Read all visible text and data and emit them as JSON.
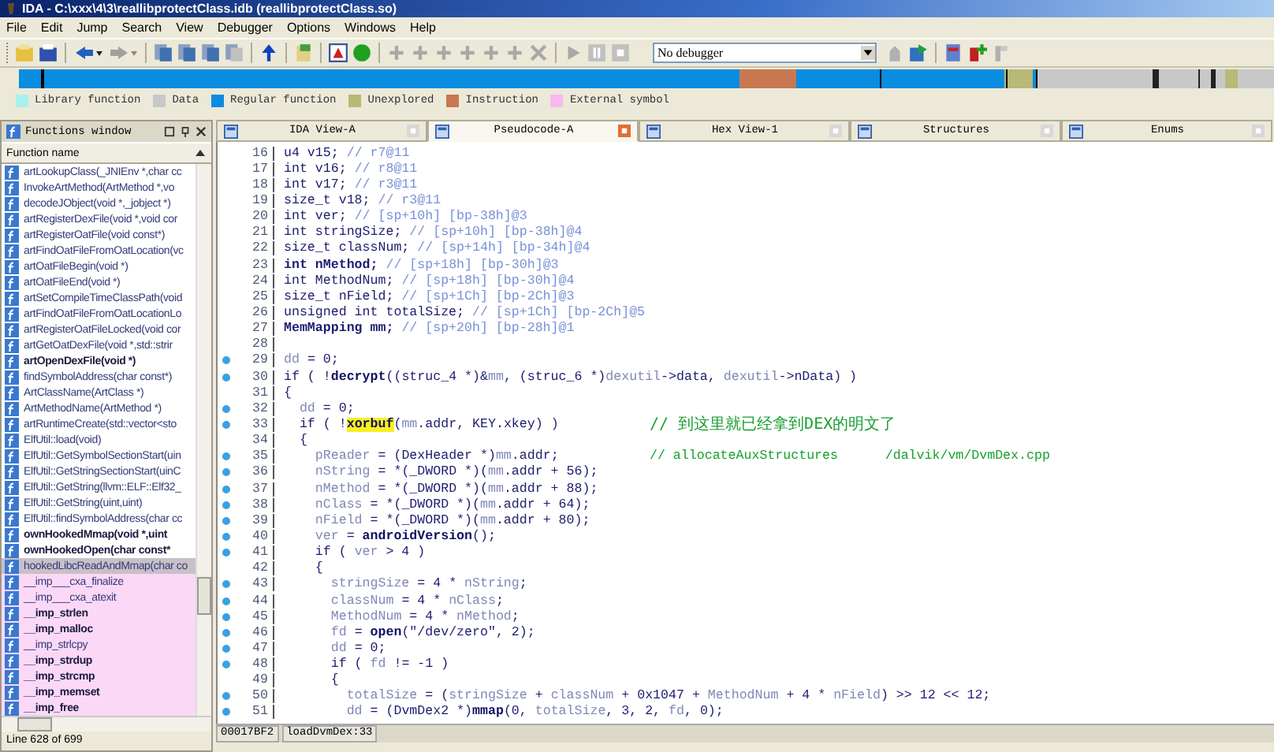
{
  "window": {
    "title": "IDA - C:\\xxx\\4\\3\\reallibprotectClass.idb (reallibprotectClass.so)"
  },
  "menu": [
    "File",
    "Edit",
    "Jump",
    "Search",
    "View",
    "Debugger",
    "Options",
    "Windows",
    "Help"
  ],
  "debugger_select": {
    "value": "No debugger"
  },
  "legend": [
    {
      "label": "Library function",
      "color": "#a8f0f0"
    },
    {
      "label": "Data",
      "color": "#c8c8c8"
    },
    {
      "label": "Regular function",
      "color": "#0a8ce0"
    },
    {
      "label": "Unexplored",
      "color": "#b8b878"
    },
    {
      "label": "Instruction",
      "color": "#c87850"
    },
    {
      "label": "External symbol",
      "color": "#f8b8f0"
    }
  ],
  "functions_window": {
    "title": "Functions window",
    "column": "Function name",
    "status": "Line 628 of 699",
    "items": [
      {
        "name": "artLookupClass(_JNIEnv *,char cc",
        "kind": "regular",
        "bold": false,
        "selected": false
      },
      {
        "name": "InvokeArtMethod(ArtMethod *,vo",
        "kind": "regular",
        "bold": false,
        "selected": false
      },
      {
        "name": "decodeJObject(void *,_jobject *)",
        "kind": "regular",
        "bold": false,
        "selected": false
      },
      {
        "name": "artRegisterDexFile(void *,void cor",
        "kind": "regular",
        "bold": false,
        "selected": false
      },
      {
        "name": "artRegisterOatFile(void const*)",
        "kind": "regular",
        "bold": false,
        "selected": false
      },
      {
        "name": "artFindOatFileFromOatLocation(vc",
        "kind": "regular",
        "bold": false,
        "selected": false
      },
      {
        "name": "artOatFileBegin(void *)",
        "kind": "regular",
        "bold": false,
        "selected": false
      },
      {
        "name": "artOatFileEnd(void *)",
        "kind": "regular",
        "bold": false,
        "selected": false
      },
      {
        "name": "artSetCompileTimeClassPath(void",
        "kind": "regular",
        "bold": false,
        "selected": false
      },
      {
        "name": "artFindOatFileFromOatLocationLo",
        "kind": "regular",
        "bold": false,
        "selected": false
      },
      {
        "name": "artRegisterOatFileLocked(void cor",
        "kind": "regular",
        "bold": false,
        "selected": false
      },
      {
        "name": "artGetOatDexFile(void *,std::strir",
        "kind": "regular",
        "bold": false,
        "selected": false
      },
      {
        "name": "artOpenDexFile(void *)",
        "kind": "regular",
        "bold": true,
        "selected": false
      },
      {
        "name": "findSymbolAddress(char const*)",
        "kind": "regular",
        "bold": false,
        "selected": false
      },
      {
        "name": "ArtClassName(ArtClass *)",
        "kind": "regular",
        "bold": false,
        "selected": false
      },
      {
        "name": "ArtMethodName(ArtMethod *)",
        "kind": "regular",
        "bold": false,
        "selected": false
      },
      {
        "name": "artRuntimeCreate(std::vector<sto",
        "kind": "regular",
        "bold": false,
        "selected": false
      },
      {
        "name": "ElfUtil::load(void)",
        "kind": "regular",
        "bold": false,
        "selected": false
      },
      {
        "name": "ElfUtil::GetSymbolSectionStart(uin",
        "kind": "regular",
        "bold": false,
        "selected": false
      },
      {
        "name": "ElfUtil::GetStringSectionStart(uinC",
        "kind": "regular",
        "bold": false,
        "selected": false
      },
      {
        "name": "ElfUtil::GetString(llvm::ELF::Elf32_",
        "kind": "regular",
        "bold": false,
        "selected": false
      },
      {
        "name": "ElfUtil::GetString(uint,uint)",
        "kind": "regular",
        "bold": false,
        "selected": false
      },
      {
        "name": "ElfUtil::findSymbolAddress(char cc",
        "kind": "regular",
        "bold": false,
        "selected": false
      },
      {
        "name": "ownHookedMmap(void *,uint",
        "kind": "regular",
        "bold": true,
        "selected": false
      },
      {
        "name": "ownHookedOpen(char const*",
        "kind": "regular",
        "bold": true,
        "selected": false
      },
      {
        "name": "hookedLibcReadAndMmap(char co",
        "kind": "regular",
        "bold": false,
        "selected": true
      },
      {
        "name": "__imp___cxa_finalize",
        "kind": "external",
        "bold": false,
        "selected": false
      },
      {
        "name": "__imp___cxa_atexit",
        "kind": "external",
        "bold": false,
        "selected": false
      },
      {
        "name": "__imp_strlen",
        "kind": "external",
        "bold": true,
        "selected": false
      },
      {
        "name": "__imp_malloc",
        "kind": "external",
        "bold": true,
        "selected": false
      },
      {
        "name": "__imp_strlcpy",
        "kind": "external",
        "bold": false,
        "selected": false
      },
      {
        "name": "__imp_strdup",
        "kind": "external",
        "bold": true,
        "selected": false
      },
      {
        "name": "__imp_strcmp",
        "kind": "external",
        "bold": true,
        "selected": false
      },
      {
        "name": "__imp_memset",
        "kind": "external",
        "bold": true,
        "selected": false
      },
      {
        "name": "__imp_free",
        "kind": "external",
        "bold": true,
        "selected": false
      }
    ]
  },
  "tabs": [
    {
      "label": "IDA View-A",
      "selected": false
    },
    {
      "label": "Pseudocode-A",
      "selected": true
    },
    {
      "label": "Hex View-1",
      "selected": false
    },
    {
      "label": "Structures",
      "selected": false
    },
    {
      "label": "Enums",
      "selected": false
    }
  ],
  "code": {
    "lines": [
      {
        "no": "16",
        "bp": false,
        "tokens": [
          {
            "kind": "plain",
            "t": "u4 v15; "
          },
          {
            "kind": "comment",
            "t": "// r7@11"
          }
        ]
      },
      {
        "no": "17",
        "bp": false,
        "tokens": [
          {
            "kind": "plain",
            "t": "int v16; "
          },
          {
            "kind": "comment",
            "t": "// r8@11"
          }
        ]
      },
      {
        "no": "18",
        "bp": false,
        "tokens": [
          {
            "kind": "plain",
            "t": "int v17; "
          },
          {
            "kind": "comment",
            "t": "// r3@11"
          }
        ]
      },
      {
        "no": "19",
        "bp": false,
        "tokens": [
          {
            "kind": "plain",
            "t": "size_t v18; "
          },
          {
            "kind": "comment",
            "t": "// r3@11"
          }
        ]
      },
      {
        "no": "20",
        "bp": false,
        "tokens": [
          {
            "kind": "plain",
            "t": "int ver; "
          },
          {
            "kind": "comment",
            "t": "// [sp+10h] [bp-38h]@3"
          }
        ]
      },
      {
        "no": "21",
        "bp": false,
        "tokens": [
          {
            "kind": "plain",
            "t": "int stringSize; "
          },
          {
            "kind": "comment",
            "t": "// [sp+10h] [bp-38h]@4"
          }
        ]
      },
      {
        "no": "22",
        "bp": false,
        "tokens": [
          {
            "kind": "plain",
            "t": "size_t classNum; "
          },
          {
            "kind": "comment",
            "t": "// [sp+14h] [bp-34h]@4"
          }
        ]
      },
      {
        "no": "23",
        "bp": false,
        "tokens": [
          {
            "kind": "bold",
            "t": "int nMethod; "
          },
          {
            "kind": "comment",
            "t": "// [sp+18h] [bp-30h]@3"
          }
        ]
      },
      {
        "no": "24",
        "bp": false,
        "tokens": [
          {
            "kind": "plain",
            "t": "int MethodNum; "
          },
          {
            "kind": "comment",
            "t": "// [sp+18h] [bp-30h]@4"
          }
        ]
      },
      {
        "no": "25",
        "bp": false,
        "tokens": [
          {
            "kind": "plain",
            "t": "size_t nField; "
          },
          {
            "kind": "comment",
            "t": "// [sp+1Ch] [bp-2Ch]@3"
          }
        ]
      },
      {
        "no": "26",
        "bp": false,
        "tokens": [
          {
            "kind": "plain",
            "t": "unsigned int totalSize; "
          },
          {
            "kind": "comment",
            "t": "// [sp+1Ch] [bp-2Ch]@5"
          }
        ]
      },
      {
        "no": "27",
        "bp": false,
        "tokens": [
          {
            "kind": "bold",
            "t": "MemMapping mm; "
          },
          {
            "kind": "comment",
            "t": "// [sp+20h] [bp-28h]@1"
          }
        ]
      },
      {
        "no": "28",
        "bp": false
      },
      {
        "no": "29",
        "bp": true,
        "tokens": [
          {
            "kind": "var",
            "t": "dd"
          },
          {
            "kind": "plain",
            "t": " = 0;"
          }
        ]
      },
      {
        "no": "30",
        "bp": true,
        "tokens": [
          {
            "kind": "plain",
            "t": "if ( !"
          },
          {
            "kind": "func",
            "t": "decrypt"
          },
          {
            "kind": "plain",
            "t": "((struc_4 *)&"
          },
          {
            "kind": "var",
            "t": "mm"
          },
          {
            "kind": "plain",
            "t": ", (struc_6 *)"
          },
          {
            "kind": "var",
            "t": "dexutil"
          },
          {
            "kind": "plain",
            "t": "->data, "
          },
          {
            "kind": "var",
            "t": "dexutil"
          },
          {
            "kind": "plain",
            "t": "->nData) )"
          }
        ]
      },
      {
        "no": "31",
        "bp": false,
        "tokens": [
          {
            "kind": "plain",
            "t": "{"
          }
        ]
      },
      {
        "no": "32",
        "bp": true,
        "tokens": [
          {
            "kind": "var",
            "t": "  dd"
          },
          {
            "kind": "plain",
            "t": " = 0;"
          }
        ]
      },
      {
        "no": "33",
        "bp": true,
        "tokens": [
          {
            "kind": "plain",
            "t": "  if ( !"
          },
          {
            "kind": "highlight",
            "t": "xorbuf"
          },
          {
            "kind": "plain",
            "t": "("
          },
          {
            "kind": "var",
            "t": "mm"
          },
          {
            "kind": "plain",
            "t": ".addr, KEY.xkey) )"
          }
        ],
        "comment": "// 到这里就已经拿到DEX的明文了"
      },
      {
        "no": "34",
        "bp": false,
        "tokens": [
          {
            "kind": "plain",
            "t": "  {"
          }
        ]
      },
      {
        "no": "35",
        "bp": true,
        "tokens": [
          {
            "kind": "var",
            "t": "    pReader"
          },
          {
            "kind": "plain",
            "t": " = (DexHeader *)"
          },
          {
            "kind": "var",
            "t": "mm"
          },
          {
            "kind": "plain",
            "t": ".addr;"
          }
        ],
        "comment": "// allocateAuxStructures      /dalvik/vm/DvmDex.cpp"
      },
      {
        "no": "36",
        "bp": true,
        "tokens": [
          {
            "kind": "var",
            "t": "    nString"
          },
          {
            "kind": "plain",
            "t": " = *(_DWORD *)("
          },
          {
            "kind": "var",
            "t": "mm"
          },
          {
            "kind": "plain",
            "t": ".addr + 56);"
          }
        ]
      },
      {
        "no": "37",
        "bp": true,
        "tokens": [
          {
            "kind": "var",
            "t": "    nMethod"
          },
          {
            "kind": "plain",
            "t": " = *(_DWORD *)("
          },
          {
            "kind": "var",
            "t": "mm"
          },
          {
            "kind": "plain",
            "t": ".addr + 88);"
          }
        ]
      },
      {
        "no": "38",
        "bp": true,
        "tokens": [
          {
            "kind": "var",
            "t": "    nClass"
          },
          {
            "kind": "plain",
            "t": " = *(_DWORD *)("
          },
          {
            "kind": "var",
            "t": "mm"
          },
          {
            "kind": "plain",
            "t": ".addr + 64);"
          }
        ]
      },
      {
        "no": "39",
        "bp": true,
        "tokens": [
          {
            "kind": "var",
            "t": "    nField"
          },
          {
            "kind": "plain",
            "t": " = *(_DWORD *)("
          },
          {
            "kind": "var",
            "t": "mm"
          },
          {
            "kind": "plain",
            "t": ".addr + 80);"
          }
        ]
      },
      {
        "no": "40",
        "bp": true,
        "tokens": [
          {
            "kind": "var",
            "t": "    ver"
          },
          {
            "kind": "plain",
            "t": " = "
          },
          {
            "kind": "func",
            "t": "androidVersion"
          },
          {
            "kind": "plain",
            "t": "();"
          }
        ]
      },
      {
        "no": "41",
        "bp": true,
        "tokens": [
          {
            "kind": "plain",
            "t": "    if ( "
          },
          {
            "kind": "var",
            "t": "ver"
          },
          {
            "kind": "plain",
            "t": " > 4 )"
          }
        ]
      },
      {
        "no": "42",
        "bp": false,
        "tokens": [
          {
            "kind": "plain",
            "t": "    {"
          }
        ]
      },
      {
        "no": "43",
        "bp": true,
        "tokens": [
          {
            "kind": "var",
            "t": "      stringSize"
          },
          {
            "kind": "plain",
            "t": " = 4 * "
          },
          {
            "kind": "var",
            "t": "nString"
          },
          {
            "kind": "plain",
            "t": ";"
          }
        ]
      },
      {
        "no": "44",
        "bp": true,
        "tokens": [
          {
            "kind": "var",
            "t": "      classNum"
          },
          {
            "kind": "plain",
            "t": " = 4 * "
          },
          {
            "kind": "var",
            "t": "nClass"
          },
          {
            "kind": "plain",
            "t": ";"
          }
        ]
      },
      {
        "no": "45",
        "bp": true,
        "tokens": [
          {
            "kind": "var",
            "t": "      MethodNum"
          },
          {
            "kind": "plain",
            "t": " = 4 * "
          },
          {
            "kind": "var",
            "t": "nMethod"
          },
          {
            "kind": "plain",
            "t": ";"
          }
        ]
      },
      {
        "no": "46",
        "bp": true,
        "tokens": [
          {
            "kind": "var",
            "t": "      fd"
          },
          {
            "kind": "plain",
            "t": " = "
          },
          {
            "kind": "func",
            "t": "open"
          },
          {
            "kind": "plain",
            "t": "(\"/dev/zero\", 2);"
          }
        ]
      },
      {
        "no": "47",
        "bp": true,
        "tokens": [
          {
            "kind": "var",
            "t": "      dd"
          },
          {
            "kind": "plain",
            "t": " = 0;"
          }
        ]
      },
      {
        "no": "48",
        "bp": true,
        "tokens": [
          {
            "kind": "plain",
            "t": "      if ( "
          },
          {
            "kind": "var",
            "t": "fd"
          },
          {
            "kind": "plain",
            "t": " != -1 )"
          }
        ]
      },
      {
        "no": "49",
        "bp": false,
        "tokens": [
          {
            "kind": "plain",
            "t": "      {"
          }
        ]
      },
      {
        "no": "50",
        "bp": true,
        "tokens": [
          {
            "kind": "var",
            "t": "        totalSize"
          },
          {
            "kind": "plain",
            "t": " = ("
          },
          {
            "kind": "var",
            "t": "stringSize"
          },
          {
            "kind": "plain",
            "t": " + "
          },
          {
            "kind": "var",
            "t": "classNum"
          },
          {
            "kind": "plain",
            "t": " + 0x1047 + "
          },
          {
            "kind": "var",
            "t": "MethodNum"
          },
          {
            "kind": "plain",
            "t": " + 4 * "
          },
          {
            "kind": "var",
            "t": "nField"
          },
          {
            "kind": "plain",
            "t": ") >> 12 << 12;"
          }
        ]
      },
      {
        "no": "51",
        "bp": true,
        "tokens": [
          {
            "kind": "var",
            "t": "        dd"
          },
          {
            "kind": "plain",
            "t": " = (DvmDex2 *)"
          },
          {
            "kind": "func",
            "t": "mmap"
          },
          {
            "kind": "plain",
            "t": "(0, "
          },
          {
            "kind": "var",
            "t": "totalSize"
          },
          {
            "kind": "plain",
            "t": ", 3, 2, "
          },
          {
            "kind": "var",
            "t": "fd"
          },
          {
            "kind": "plain",
            "t": ", 0);"
          }
        ]
      }
    ],
    "status": [
      "00017BF2",
      "loadDvmDex:33"
    ]
  }
}
